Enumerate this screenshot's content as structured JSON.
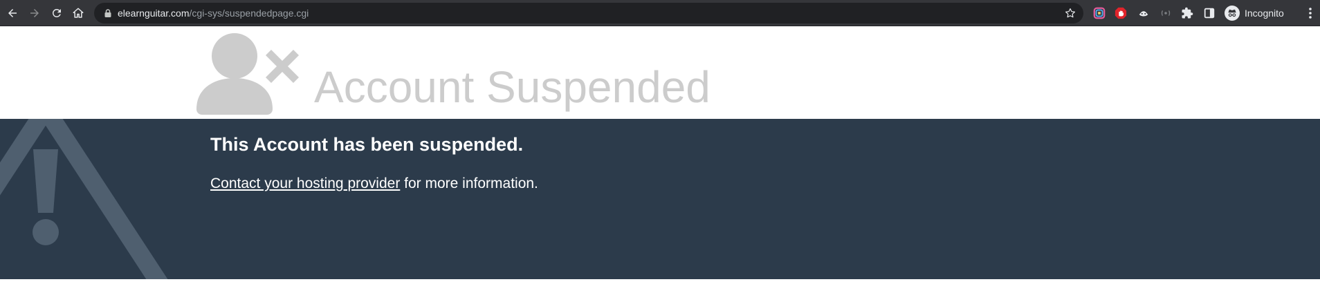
{
  "browser": {
    "url_host": "elearnguitar.com",
    "url_path": "/cgi-sys/suspendedpage.cgi",
    "profile_label": "Incognito",
    "icons": {
      "back": "back-arrow-icon",
      "forward": "forward-arrow-icon",
      "reload": "reload-icon",
      "home": "home-icon",
      "lock": "lock-icon",
      "bookmark": "star-icon",
      "extensions": [
        "color-picker-extension-icon",
        "adblock-hand-extension-icon",
        "hat-extension-icon",
        "media-extension-icon",
        "puzzle-extensions-icon",
        "side-panel-icon"
      ],
      "incognito": "incognito-icon",
      "menu": "kebab-menu-icon"
    }
  },
  "page": {
    "title": "Account Suspended",
    "notice": {
      "heading": "This Account has been suspended.",
      "link_text": "Contact your hosting provider",
      "body_suffix": " for more information."
    }
  },
  "colors": {
    "toolbar_bg": "#35363a",
    "omnibox_bg": "#202124",
    "title_gray": "#cccccc",
    "band_bg": "#2c3b4b",
    "warning_icon": "#4f5f6f"
  }
}
